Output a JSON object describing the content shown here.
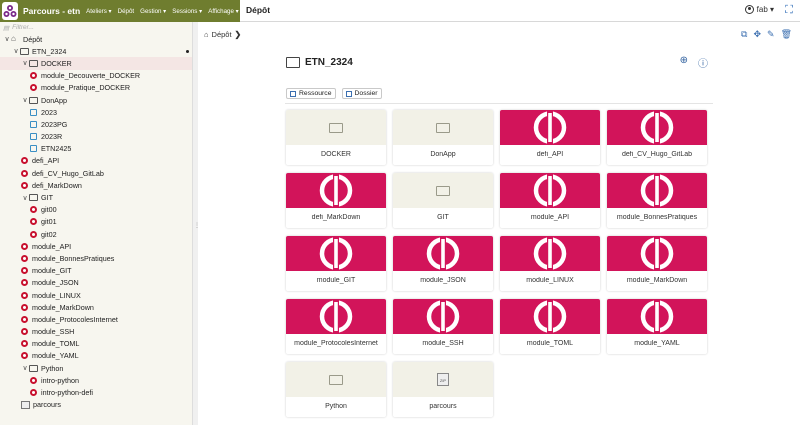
{
  "topbar": {
    "app_title": "Parcours - etn",
    "menus": [
      "Ateliers ▾",
      "Dépôt",
      "Gestion ▾",
      "Sessions ▾",
      "Affichage ▾"
    ],
    "collapse": "«",
    "heading": "Dépôt",
    "user": "fab ▾",
    "colors": {
      "brand": "#6f7d2f",
      "module": "#d2145a"
    }
  },
  "sidebar": {
    "filter_placeholder": "Filtrer...",
    "tree": [
      {
        "label": "Dépôt",
        "type": "home",
        "level": 0,
        "chevron": "∨"
      },
      {
        "label": "ETN_2324",
        "type": "folder",
        "level": 1,
        "chevron": "∨",
        "current": true
      },
      {
        "label": "DOCKER",
        "type": "folder",
        "level": 2,
        "chevron": "∨",
        "selected": true
      },
      {
        "label": "module_Decouverte_DOCKER",
        "type": "module",
        "level": 3
      },
      {
        "label": "module_Pratique_DOCKER",
        "type": "module",
        "level": 3
      },
      {
        "label": "DonApp",
        "type": "folder",
        "level": 2,
        "chevron": "∨"
      },
      {
        "label": "2023",
        "type": "calendar",
        "level": 3
      },
      {
        "label": "2023PG",
        "type": "calendar",
        "level": 3
      },
      {
        "label": "2023R",
        "type": "calendar",
        "level": 3
      },
      {
        "label": "ETN2425",
        "type": "calendar",
        "level": 3
      },
      {
        "label": "defi_API",
        "type": "module",
        "level": 2
      },
      {
        "label": "defi_CV_Hugo_GitLab",
        "type": "module",
        "level": 2
      },
      {
        "label": "defi_MarkDown",
        "type": "module",
        "level": 2
      },
      {
        "label": "GIT",
        "type": "folder",
        "level": 2,
        "chevron": "∨"
      },
      {
        "label": "git00",
        "type": "module",
        "level": 3
      },
      {
        "label": "git01",
        "type": "module",
        "level": 3
      },
      {
        "label": "git02",
        "type": "module",
        "level": 3
      },
      {
        "label": "module_API",
        "type": "module",
        "level": 2
      },
      {
        "label": "module_BonnesPratiques",
        "type": "module",
        "level": 2
      },
      {
        "label": "module_GIT",
        "type": "module",
        "level": 2
      },
      {
        "label": "module_JSON",
        "type": "module",
        "level": 2
      },
      {
        "label": "module_LINUX",
        "type": "module",
        "level": 2
      },
      {
        "label": "module_MarkDown",
        "type": "module",
        "level": 2
      },
      {
        "label": "module_ProtocolesInternet",
        "type": "module",
        "level": 2
      },
      {
        "label": "module_SSH",
        "type": "module",
        "level": 2
      },
      {
        "label": "module_TOML",
        "type": "module",
        "level": 2
      },
      {
        "label": "module_YAML",
        "type": "module",
        "level": 2
      },
      {
        "label": "Python",
        "type": "folder",
        "level": 2,
        "chevron": "∨"
      },
      {
        "label": "intro-python",
        "type": "module",
        "level": 3
      },
      {
        "label": "intro-python-defi",
        "type": "module",
        "level": 3
      },
      {
        "label": "parcours",
        "type": "zip",
        "level": 2
      }
    ]
  },
  "main": {
    "breadcrumb": "Dépôt",
    "breadcrumb_sep": "❯",
    "folder_title": "ETN_2324",
    "buttons": {
      "ressource": "Ressource",
      "dossier": "Dossier"
    },
    "items": [
      {
        "label": "DOCKER",
        "type": "folder"
      },
      {
        "label": "DonApp",
        "type": "folder"
      },
      {
        "label": "defi_API",
        "type": "module"
      },
      {
        "label": "defi_CV_Hugo_GitLab",
        "type": "module"
      },
      {
        "label": "defi_MarkDown",
        "type": "module"
      },
      {
        "label": "GIT",
        "type": "folder"
      },
      {
        "label": "module_API",
        "type": "module"
      },
      {
        "label": "module_BonnesPratiques",
        "type": "module"
      },
      {
        "label": "module_GIT",
        "type": "module"
      },
      {
        "label": "module_JSON",
        "type": "module"
      },
      {
        "label": "module_LINUX",
        "type": "module"
      },
      {
        "label": "module_MarkDown",
        "type": "module"
      },
      {
        "label": "module_ProtocolesInternet",
        "type": "module"
      },
      {
        "label": "module_SSH",
        "type": "module"
      },
      {
        "label": "module_TOML",
        "type": "module"
      },
      {
        "label": "module_YAML",
        "type": "module"
      },
      {
        "label": "Python",
        "type": "folder"
      },
      {
        "label": "parcours",
        "type": "zip"
      }
    ]
  }
}
